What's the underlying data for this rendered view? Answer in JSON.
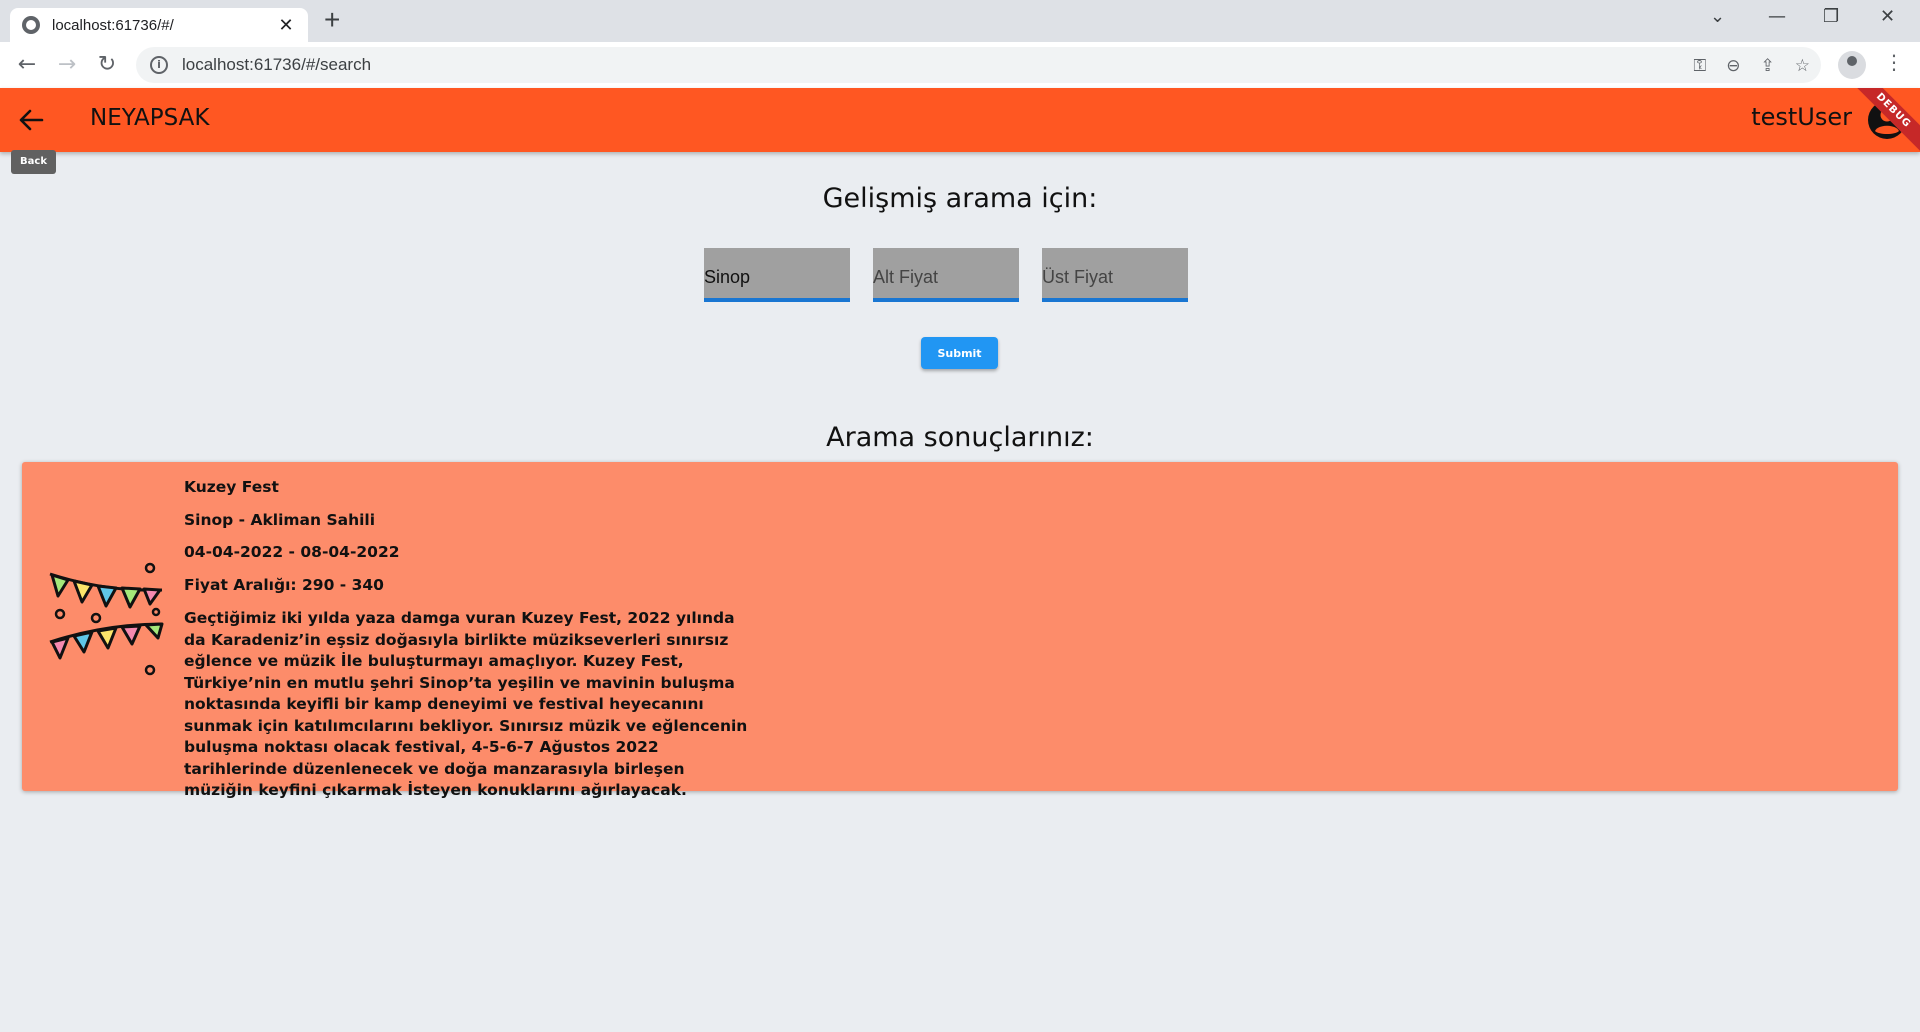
{
  "browser": {
    "tab_title": "localhost:61736/#/",
    "url": "localhost:61736/#/search"
  },
  "appbar": {
    "app_name": "NEYAPSAK",
    "username": "testUser",
    "back_tooltip": "Back",
    "debug_banner": "DEBUG",
    "color": "#ff5722"
  },
  "search": {
    "heading": "Gelişmiş arama için:",
    "city_value": "Sinop",
    "min_price_placeholder": "Alt Fiyat",
    "max_price_placeholder": "Üst Fiyat",
    "submit_label": "Submit"
  },
  "results": {
    "heading": "Arama sonuçlarınız:",
    "items": [
      {
        "name": "Kuzey Fest",
        "location": "Sinop  -  Akliman Sahili",
        "dates": "04-04-2022  -  08-04-2022",
        "price": "Fiyat Aralığı: 290  -  340",
        "description": "Geçtiğimiz iki yılda yaza damga vuran Kuzey Fest, 2022 yılında da Karadeniz’in eşsiz doğasıyla birlikte müzikseverleri sınırsız eğlence ve müzik İle buluşturmayı amaçlıyor. Kuzey Fest, Türkiye’nin en mutlu şehri Sinop’ta yeşilin ve mavinin buluşma noktasında keyifli bir kamp deneyimi ve festival heyecanını sunmak için katılımcılarını bekliyor. Sınırsız müzik ve eğlencenin buluşma noktası olacak festival, 4-5-6-7 Ağustos 2022 tarihlerinde düzenlenecek ve doğa manzarasıyla birleşen müziğin keyfini çıkarmak İsteyen konuklarını ağırlayacak.",
        "icon": "bunting-icon",
        "card_color": "#fd8c6a"
      }
    ]
  }
}
